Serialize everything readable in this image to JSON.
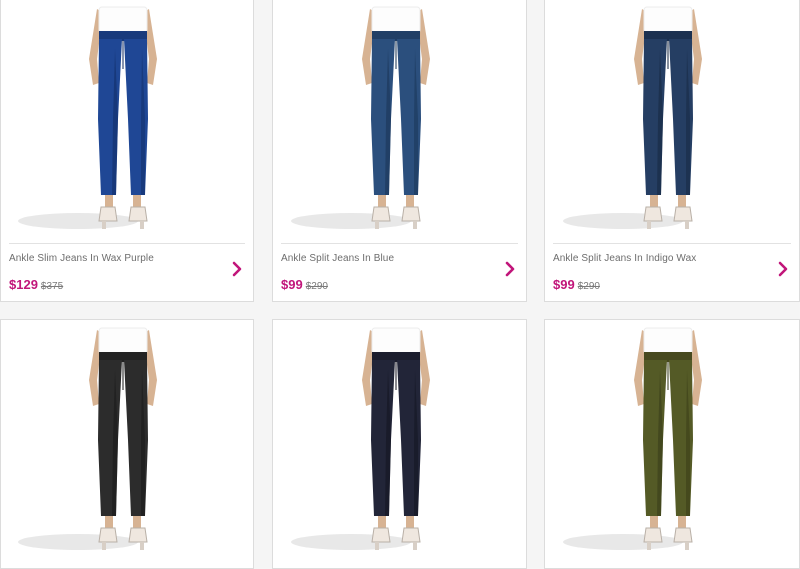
{
  "products": [
    {
      "name": "Ankle Slim Jeans In Wax Purple",
      "price": "$129",
      "original_price": "$375",
      "color": "#1f4795",
      "dark": "#183a7c",
      "shadow": "#0f2a5f"
    },
    {
      "name": "Ankle Split Jeans In Blue",
      "price": "$99",
      "original_price": "$290",
      "color": "#2b4f7d",
      "dark": "#213f66",
      "shadow": "#17304f"
    },
    {
      "name": "Ankle Split Jeans In Indigo Wax",
      "price": "$99",
      "original_price": "$290",
      "color": "#253e63",
      "dark": "#1c3150",
      "shadow": "#13233b"
    },
    {
      "name": "",
      "price": "",
      "original_price": "",
      "color": "#2c2c2c",
      "dark": "#222222",
      "shadow": "#151515"
    },
    {
      "name": "",
      "price": "",
      "original_price": "",
      "color": "#222538",
      "dark": "#1b1d2d",
      "shadow": "#10111c"
    },
    {
      "name": "",
      "price": "",
      "original_price": "",
      "color": "#545a26",
      "dark": "#47491f",
      "shadow": "#323515"
    }
  ],
  "theme": {
    "accent": "#c1157a",
    "skin": "#d7b393",
    "top": "#fdfdfd"
  }
}
